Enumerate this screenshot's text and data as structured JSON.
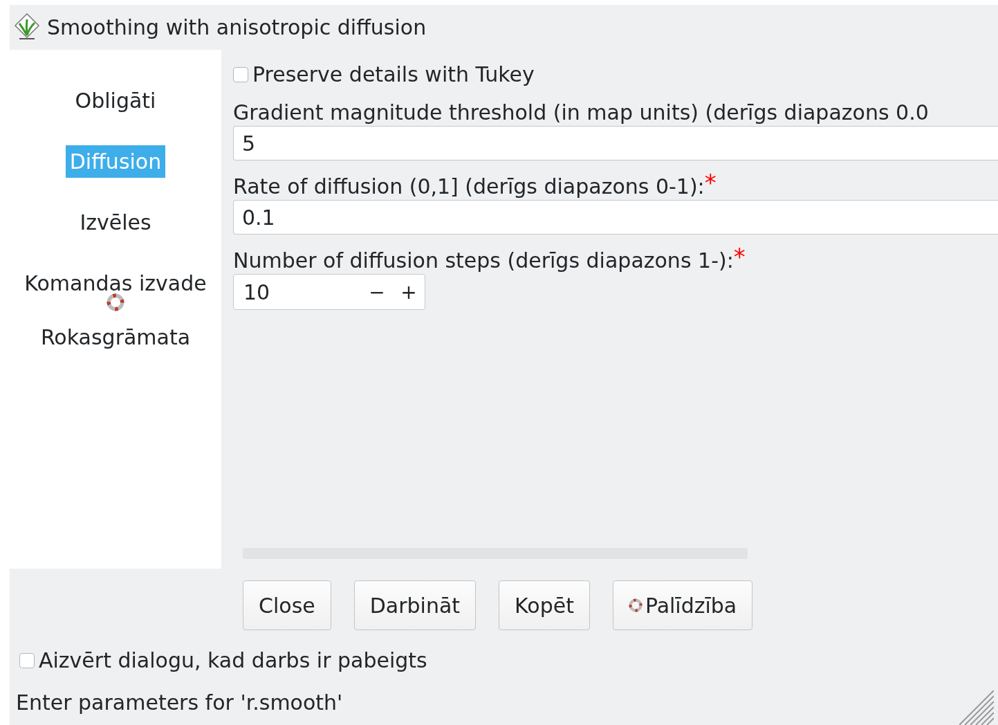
{
  "window": {
    "title": "Smoothing with anisotropic diffusion"
  },
  "sidebar": {
    "items": [
      {
        "label": "Obligāti",
        "selected": false,
        "kind": "text"
      },
      {
        "label": "Diffusion",
        "selected": true,
        "kind": "text"
      },
      {
        "label": "Izvēles",
        "selected": false,
        "kind": "text"
      },
      {
        "label": "Komandas izvade",
        "selected": false,
        "kind": "text"
      },
      {
        "label": "Rokasgrāmata",
        "selected": false,
        "kind": "help"
      }
    ]
  },
  "options": [
    {
      "kind": "checkbox",
      "label": "Preserve details with Tukey",
      "checked": false
    },
    {
      "kind": "text",
      "label": "Gradient magnitude threshold (in map units) (derīgs diapazons 0.0",
      "value": "5"
    },
    {
      "kind": "text",
      "label": "Rate of diffusion (0,1] (derīgs diapazons 0-1):",
      "asterisk": "*",
      "value": "0.1"
    },
    {
      "kind": "spin",
      "label": "Number of diffusion steps (derīgs diapazons 1-):",
      "asterisk": "*",
      "value": "10",
      "decrement": "−",
      "increment": "+"
    }
  ],
  "progress": {
    "level": 0
  },
  "buttons": [
    {
      "label": "Close",
      "kind": "plain"
    },
    {
      "label": "Darbināt",
      "kind": "plain"
    },
    {
      "label": "Kopēt",
      "kind": "plain"
    },
    {
      "label": "Palīdzība",
      "kind": "help"
    }
  ],
  "close_on_finish": {
    "label": "Aizvērt dialogu, kad darbs ir pabeigts",
    "checked": false
  },
  "status_bar": "Enter parameters for 'r.smooth'"
}
